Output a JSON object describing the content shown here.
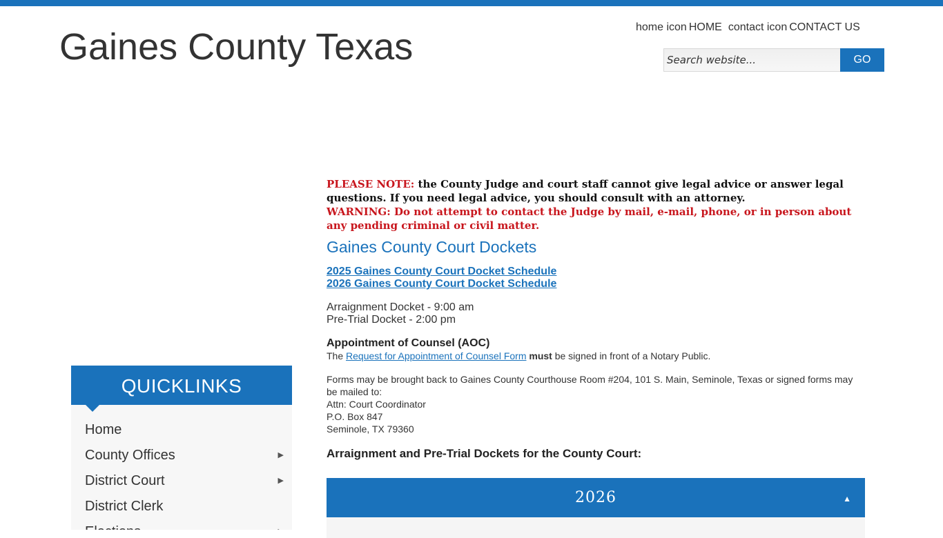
{
  "site": {
    "title": "Gaines County Texas",
    "accent_color": "#1a72bb",
    "warning_color": "#c8161d"
  },
  "header": {
    "home_icon_alt": "home icon",
    "home_label": "HOME",
    "contact_icon_alt": "contact icon",
    "contact_label": "CONTACT US",
    "search_placeholder": "Search website...",
    "search_button": "GO"
  },
  "quicklinks": {
    "title": "QUICKLINKS",
    "items": [
      {
        "label": "Home",
        "has_submenu": false
      },
      {
        "label": "County Offices",
        "has_submenu": true
      },
      {
        "label": "District Court",
        "has_submenu": true
      },
      {
        "label": "District Clerk",
        "has_submenu": false
      },
      {
        "label": "Elections",
        "has_submenu": true
      }
    ],
    "submenu_icon": "triangle-right-icon"
  },
  "main": {
    "note_label": "PLEASE NOTE:",
    "note_text": " the County Judge and court staff cannot give legal advice or answer legal questions.  If you need legal advice, you should consult with an attorney.",
    "warning_text": "WARNING:  Do not attempt to contact the Judge by mail, e-mail, phone, or in person about any pending criminal or civil matter.",
    "section_title": "Gaines County Court Dockets",
    "docket_links": [
      "2025 Gaines County Court Docket Schedule",
      "2026 Gaines County Court Docket Schedule"
    ],
    "arraignment_time": "Arraignment Docket - 9:00 am",
    "pretrial_time": "Pre-Trial Docket - 2:00 pm",
    "aoc_title": "Appointment of Counsel (AOC)",
    "aoc_prefix": "The ",
    "aoc_link": "Request for Appointment of Counsel Form",
    "aoc_must": "must",
    "aoc_suffix": " be signed in front of a Notary Public.",
    "forms_text": "Forms may be brought back to Gaines County Courthouse Room #204, 101 S. Main, Seminole, Texas or signed forms may be mailed to:",
    "address_lines": [
      "Attn: Court Coordinator",
      "P.O. Box 847",
      "Seminole, TX 79360"
    ],
    "arraign_heading": "Arraignment and Pre-Trial Dockets for the County Court:",
    "accordion_label": "2026",
    "accordion_icon": "triangle-up-icon"
  }
}
